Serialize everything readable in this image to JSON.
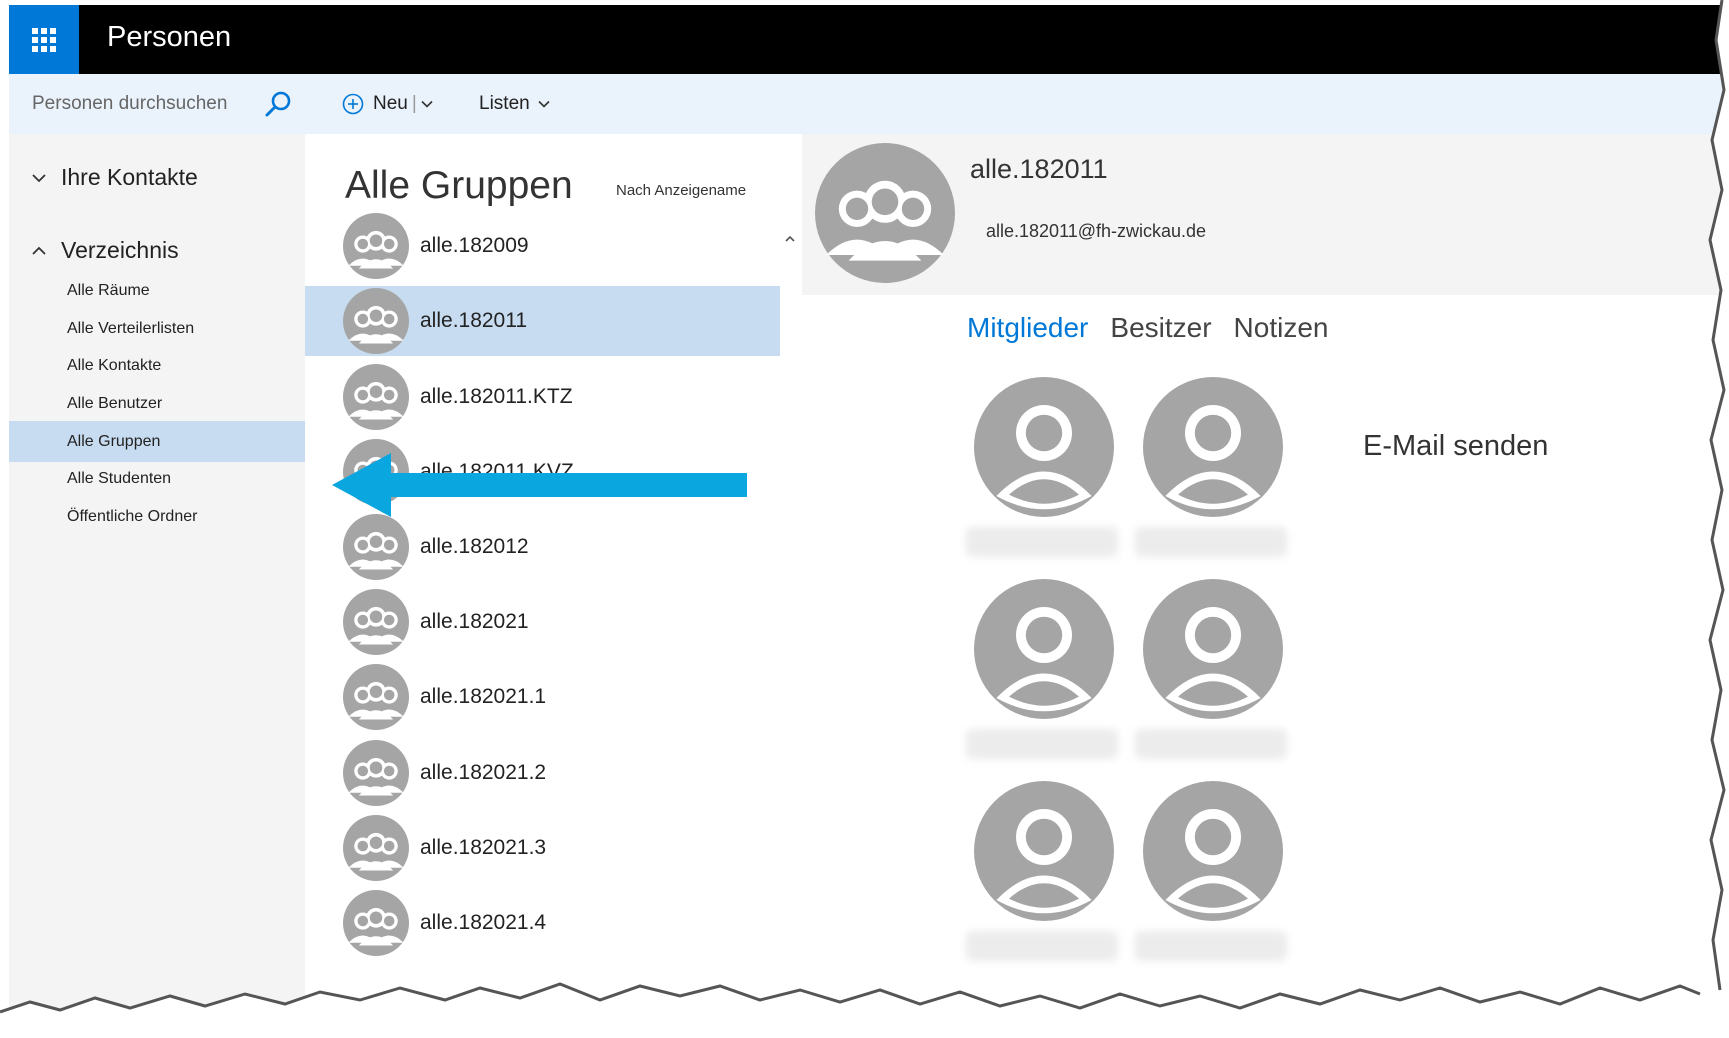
{
  "app": {
    "title": "Personen"
  },
  "search": {
    "placeholder": "Personen durchsuchen"
  },
  "commands": {
    "new_label": "Neu",
    "new_separator": "|",
    "lists_label": "Listen"
  },
  "nav": {
    "sections": [
      {
        "label": "Ihre Kontakte",
        "expanded": false
      },
      {
        "label": "Verzeichnis",
        "expanded": true
      }
    ],
    "items": [
      {
        "label": "Alle Räume",
        "selected": false
      },
      {
        "label": "Alle Verteilerlisten",
        "selected": false
      },
      {
        "label": "Alle Kontakte",
        "selected": false
      },
      {
        "label": "Alle Benutzer",
        "selected": false
      },
      {
        "label": "Alle Gruppen",
        "selected": true
      },
      {
        "label": "Alle Studenten",
        "selected": false
      },
      {
        "label": "Öffentliche Ordner",
        "selected": false
      }
    ]
  },
  "list": {
    "title": "Alle Gruppen",
    "sort_label": "Nach Anzeigename",
    "items": [
      {
        "name": "alle.182009",
        "selected": false
      },
      {
        "name": "alle.182011",
        "selected": true
      },
      {
        "name": "alle.182011.KTZ",
        "selected": false
      },
      {
        "name": "alle.182011.KVZ",
        "selected": false
      },
      {
        "name": "alle.182012",
        "selected": false
      },
      {
        "name": "alle.182021",
        "selected": false
      },
      {
        "name": "alle.182021.1",
        "selected": false
      },
      {
        "name": "alle.182021.2",
        "selected": false
      },
      {
        "name": "alle.182021.3",
        "selected": false
      },
      {
        "name": "alle.182021.4",
        "selected": false
      }
    ]
  },
  "detail": {
    "name": "alle.182011",
    "email": "alle.182011@fh-zwickau.de",
    "tabs": [
      {
        "label": "Mitglieder",
        "active": true
      },
      {
        "label": "Besitzer",
        "active": false
      },
      {
        "label": "Notizen",
        "active": false
      }
    ],
    "send_mail_label": "E-Mail senden",
    "member_count_shown": 6
  },
  "colors": {
    "accent": "#0078d7",
    "topbar": "#000000",
    "command_bar": "#eaf2fb",
    "selection": "#c7dcf0",
    "annotation_arrow": "#0aa6df"
  }
}
